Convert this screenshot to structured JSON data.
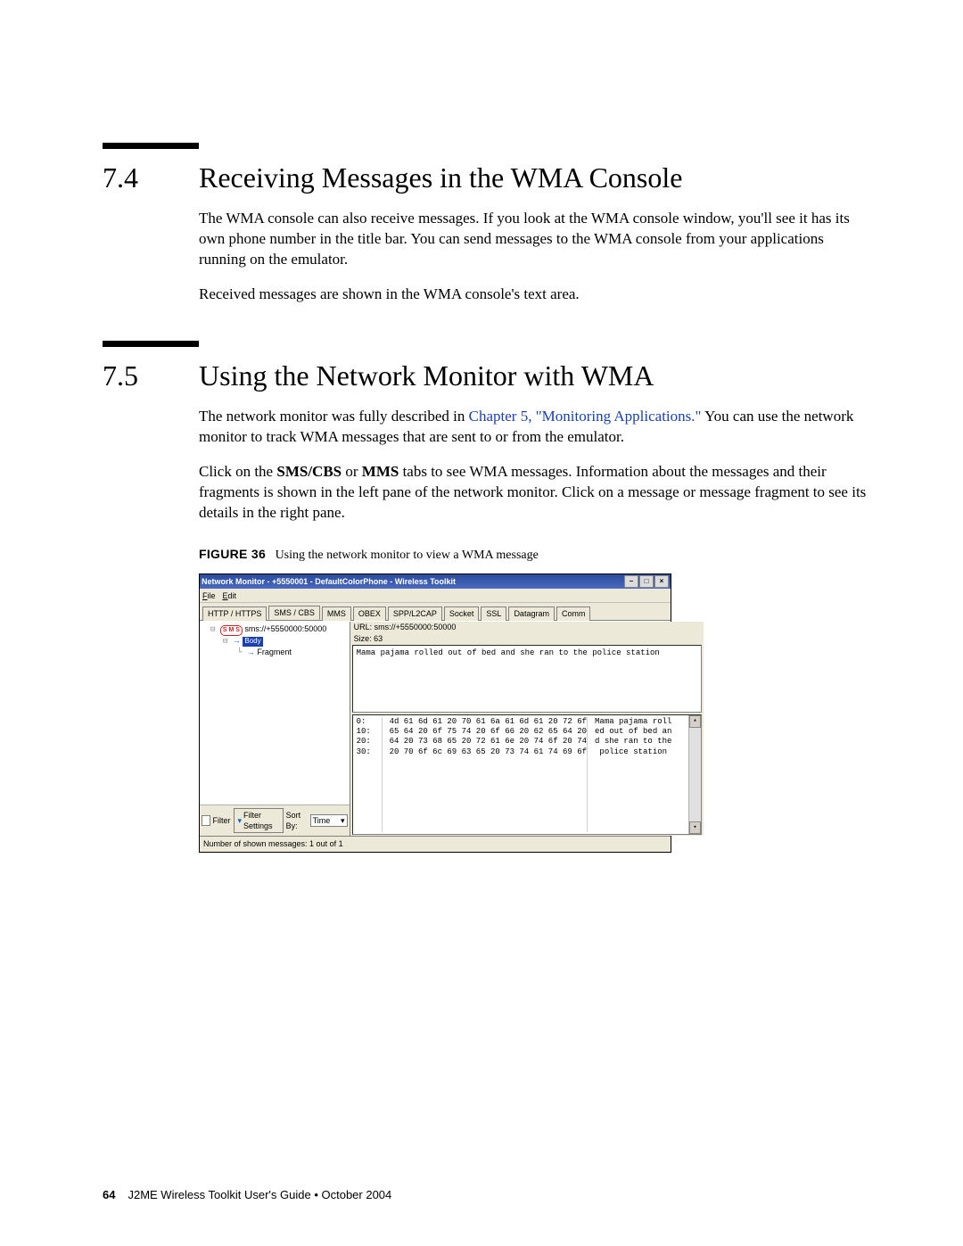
{
  "section74": {
    "number": "7.4",
    "title": "Receiving Messages in the WMA Console",
    "p1": "The WMA console can also receive messages. If you look at the WMA console window, you'll see it has its own phone number in the title bar. You can send messages to the WMA console from your applications running on the emulator.",
    "p2": "Received messages are shown in the WMA console's text area."
  },
  "section75": {
    "number": "7.5",
    "title": "Using the Network Monitor with WMA",
    "p1a": "The network monitor was fully described in ",
    "p1_link": "Chapter 5, \"Monitoring Applications.\"",
    "p1b": " You can use the network monitor to track WMA messages that are sent to or from the emulator.",
    "p2a": "Click on the ",
    "p2b1": "SMS/CBS",
    "p2c": " or ",
    "p2b2": "MMS",
    "p2d": " tabs to see WMA messages. Information about the messages and their fragments is shown in the left pane of the network monitor. Click on a message or message fragment to see its details in the right pane."
  },
  "figure": {
    "label": "FIGURE 36",
    "caption": "Using the network monitor to view a WMA message"
  },
  "window": {
    "title": "Network Monitor - +5550001 - DefaultColorPhone - Wireless Toolkit",
    "menu": {
      "file": "File",
      "edit": "Edit"
    },
    "tabs": [
      "HTTP / HTTPS",
      "SMS / CBS",
      "MMS",
      "OBEX",
      "SPP/L2CAP",
      "Socket",
      "SSL",
      "Datagram",
      "Comm"
    ],
    "active_tab_index": 1,
    "tree": {
      "sms_badge": "S M S",
      "sms_label": "sms://+5550000:50000",
      "body_label": "Body",
      "fragment_label": "Fragment"
    },
    "filter_bar": {
      "filter_chk": "Filter",
      "filter_settings": "Filter Settings",
      "sort_label": "Sort By:",
      "sort_value": "Time"
    },
    "right": {
      "url": "URL: sms://+5550000:50000",
      "size": "Size: 63",
      "text": "Mama pajama rolled out of bed and she ran to the police station"
    },
    "hex": {
      "offsets": [
        "0:",
        "10:",
        "20:",
        "30:"
      ],
      "rows": [
        "4d 61 6d 61 20 70 61 6a 61 6d 61 20 72 6f",
        "65 64 20 6f 75 74 20 6f 66 20 62 65 64 20",
        "64 20 73 68 65 20 72 61 6e 20 74 6f 20 74",
        "20 70 6f 6c 69 63 65 20 73 74 61 74 69 6f"
      ],
      "ascii": [
        "Mama pajama roll",
        "ed out of bed an",
        "d she ran to the",
        " police station"
      ]
    },
    "status": "Number of shown messages: 1 out of 1"
  },
  "footer": {
    "page": "64",
    "text": "J2ME Wireless Toolkit User's Guide  •  October 2004"
  }
}
